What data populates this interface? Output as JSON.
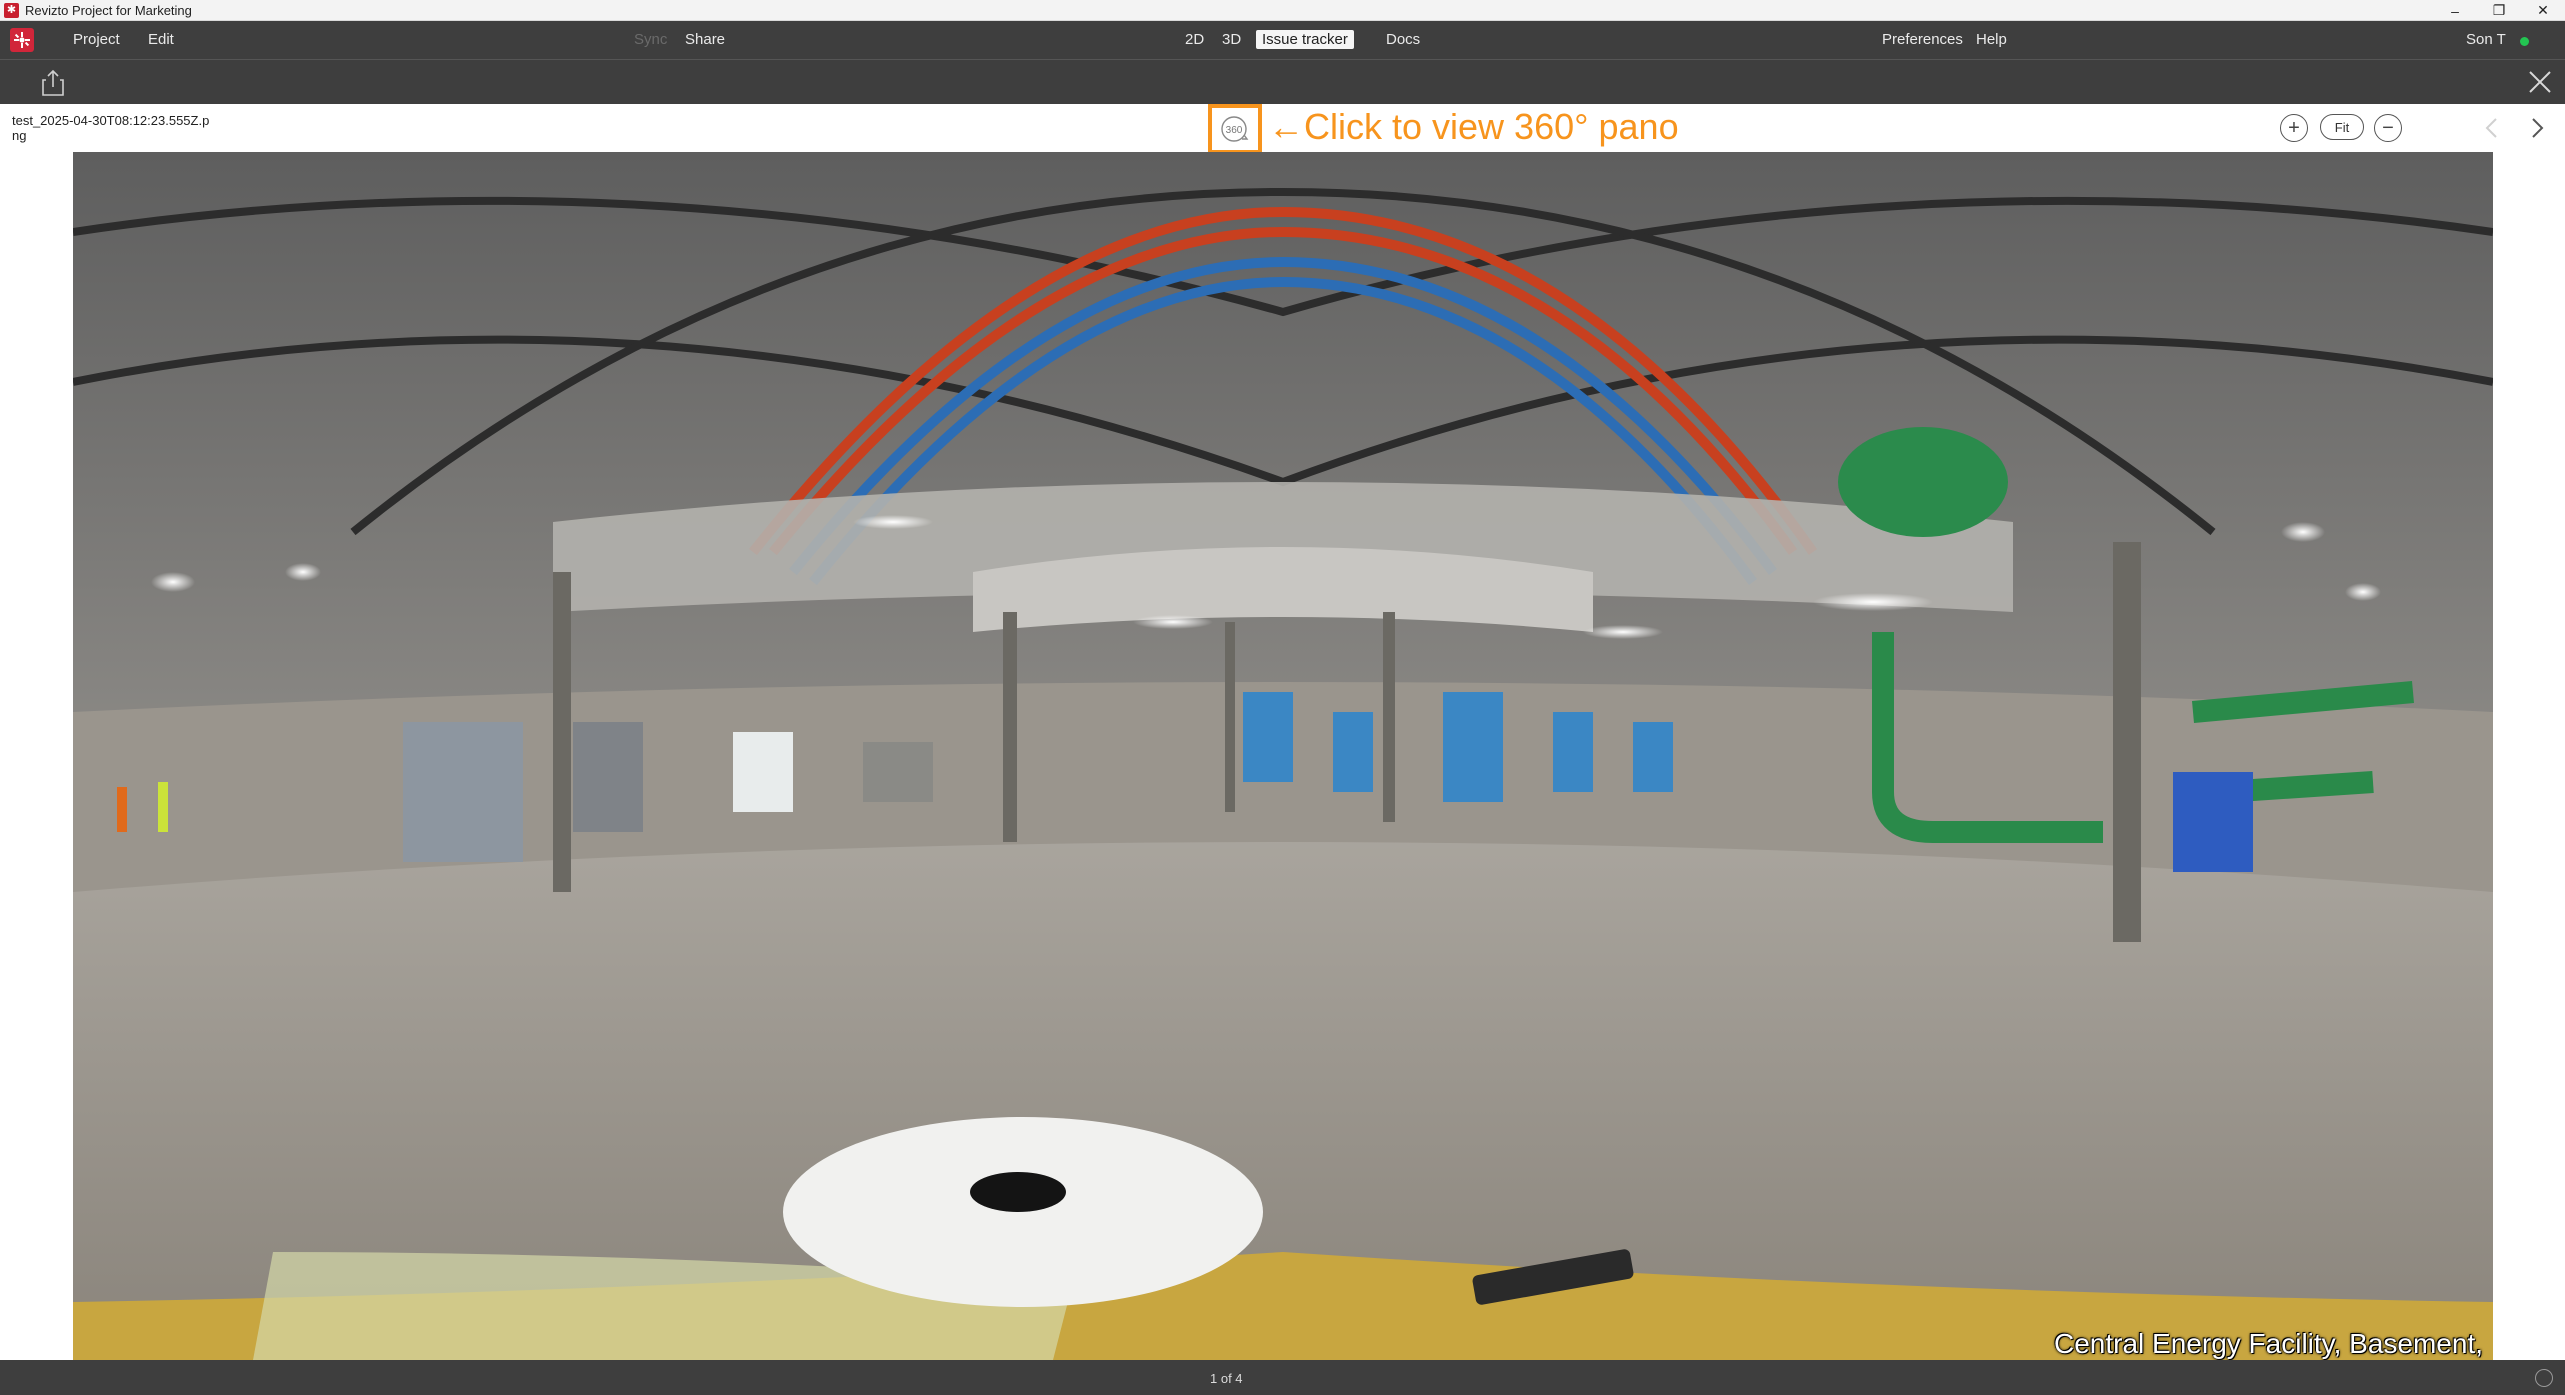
{
  "window": {
    "title": "Revizto Project for Marketing",
    "controls": [
      "–",
      "❐",
      "✕"
    ]
  },
  "menubar": {
    "items": {
      "project": "Project",
      "edit": "Edit",
      "sync": "Sync",
      "share": "Share",
      "view_2d": "2D",
      "view_3d": "3D",
      "issue_tracker": "Issue tracker",
      "docs": "Docs",
      "preferences": "Preferences",
      "help": "Help"
    },
    "user": "Son T",
    "status_color": "#23c552"
  },
  "viewer": {
    "filename": "test_2025-04-30T08:12:23.555Z.png",
    "pano_button_label": "360",
    "pano_note": "←Click to view 360° pano",
    "fit_label": "Fit",
    "zoom_in": "+",
    "zoom_out": "−",
    "caption": "Central Energy Facility, Basement,"
  },
  "footer": {
    "pager": "1 of 4"
  },
  "colors": {
    "accent": "#f7941d",
    "chrome": "#3e3e3e",
    "brand": "#d1263a"
  }
}
